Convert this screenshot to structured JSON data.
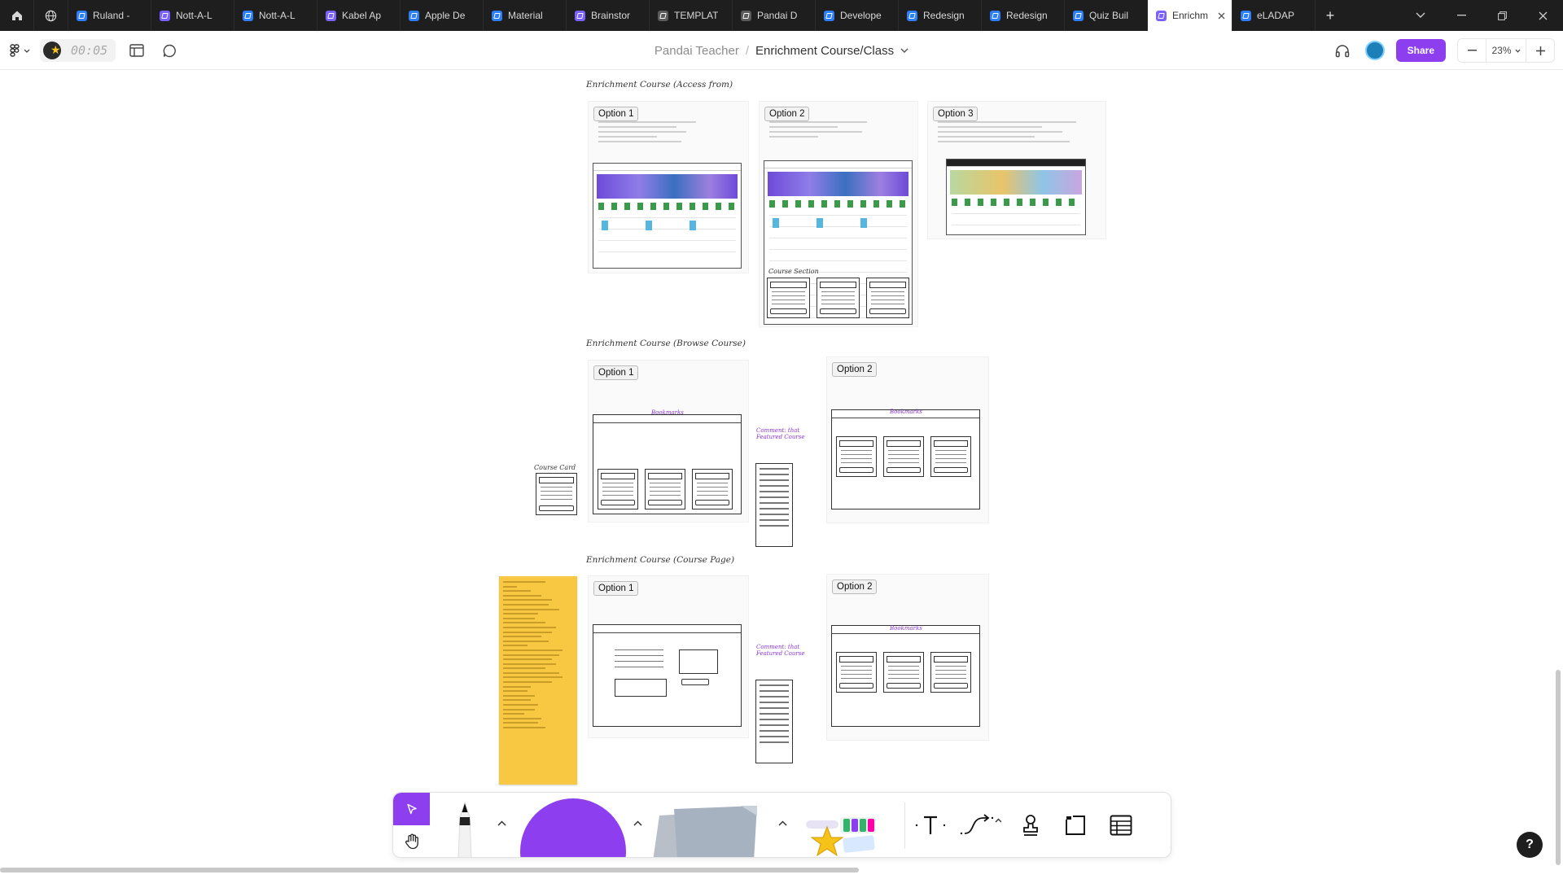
{
  "browser": {
    "tabs": [
      {
        "label": "Ruland -",
        "icon": "blue"
      },
      {
        "label": "Nott-A-L",
        "icon": "purple"
      },
      {
        "label": "Nott-A-L",
        "icon": "blue"
      },
      {
        "label": "Kabel Ap",
        "icon": "purple"
      },
      {
        "label": "Apple De",
        "icon": "blue"
      },
      {
        "label": "Material",
        "icon": "blue"
      },
      {
        "label": "Brainstor",
        "icon": "purple"
      },
      {
        "label": "TEMPLAT",
        "icon": "grey"
      },
      {
        "label": "Pandai D",
        "icon": "grey"
      },
      {
        "label": "Develope",
        "icon": "blue"
      },
      {
        "label": "Redesign",
        "icon": "blue"
      },
      {
        "label": "Redesign",
        "icon": "blue"
      },
      {
        "label": "Quiz Buil",
        "icon": "blue"
      },
      {
        "label": "Enrichm",
        "icon": "purple",
        "active": true
      },
      {
        "label": "eLADAP",
        "icon": "blue"
      }
    ],
    "new_tab_symbol": "+"
  },
  "toolbar": {
    "timer": "00:05",
    "team_name": "Pandai Teacher",
    "separator": "/",
    "file_name": "Enrichment Course/Class",
    "share_label": "Share",
    "zoom": "23%"
  },
  "canvas": {
    "sections": [
      {
        "title": "Enrichment Course (Access from)"
      },
      {
        "title": "Enrichment Course (Browse Course)"
      },
      {
        "title": "Enrichment Course (Course Page)"
      }
    ],
    "option_labels": {
      "access_1": "Option 1",
      "access_2": "Option 2",
      "access_3": "Option 3",
      "browse_1": "Option 1",
      "browse_2": "Option 2",
      "page_1": "Option 1",
      "page_2": "Option 2"
    },
    "sketch_labels": {
      "course_card": "Course Card",
      "course_section": "Course Section",
      "bookmark": "Bookmarks",
      "comment": "Comment: that Featured Course"
    }
  },
  "help_label": "?"
}
